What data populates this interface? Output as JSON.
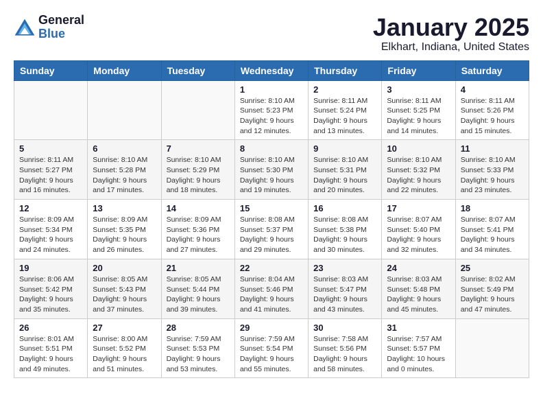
{
  "header": {
    "logo_general": "General",
    "logo_blue": "Blue",
    "month_title": "January 2025",
    "location": "Elkhart, Indiana, United States"
  },
  "days_of_week": [
    "Sunday",
    "Monday",
    "Tuesday",
    "Wednesday",
    "Thursday",
    "Friday",
    "Saturday"
  ],
  "weeks": [
    [
      {
        "day": "",
        "info": ""
      },
      {
        "day": "",
        "info": ""
      },
      {
        "day": "",
        "info": ""
      },
      {
        "day": "1",
        "info": "Sunrise: 8:10 AM\nSunset: 5:23 PM\nDaylight: 9 hours\nand 12 minutes."
      },
      {
        "day": "2",
        "info": "Sunrise: 8:11 AM\nSunset: 5:24 PM\nDaylight: 9 hours\nand 13 minutes."
      },
      {
        "day": "3",
        "info": "Sunrise: 8:11 AM\nSunset: 5:25 PM\nDaylight: 9 hours\nand 14 minutes."
      },
      {
        "day": "4",
        "info": "Sunrise: 8:11 AM\nSunset: 5:26 PM\nDaylight: 9 hours\nand 15 minutes."
      }
    ],
    [
      {
        "day": "5",
        "info": "Sunrise: 8:11 AM\nSunset: 5:27 PM\nDaylight: 9 hours\nand 16 minutes."
      },
      {
        "day": "6",
        "info": "Sunrise: 8:10 AM\nSunset: 5:28 PM\nDaylight: 9 hours\nand 17 minutes."
      },
      {
        "day": "7",
        "info": "Sunrise: 8:10 AM\nSunset: 5:29 PM\nDaylight: 9 hours\nand 18 minutes."
      },
      {
        "day": "8",
        "info": "Sunrise: 8:10 AM\nSunset: 5:30 PM\nDaylight: 9 hours\nand 19 minutes."
      },
      {
        "day": "9",
        "info": "Sunrise: 8:10 AM\nSunset: 5:31 PM\nDaylight: 9 hours\nand 20 minutes."
      },
      {
        "day": "10",
        "info": "Sunrise: 8:10 AM\nSunset: 5:32 PM\nDaylight: 9 hours\nand 22 minutes."
      },
      {
        "day": "11",
        "info": "Sunrise: 8:10 AM\nSunset: 5:33 PM\nDaylight: 9 hours\nand 23 minutes."
      }
    ],
    [
      {
        "day": "12",
        "info": "Sunrise: 8:09 AM\nSunset: 5:34 PM\nDaylight: 9 hours\nand 24 minutes."
      },
      {
        "day": "13",
        "info": "Sunrise: 8:09 AM\nSunset: 5:35 PM\nDaylight: 9 hours\nand 26 minutes."
      },
      {
        "day": "14",
        "info": "Sunrise: 8:09 AM\nSunset: 5:36 PM\nDaylight: 9 hours\nand 27 minutes."
      },
      {
        "day": "15",
        "info": "Sunrise: 8:08 AM\nSunset: 5:37 PM\nDaylight: 9 hours\nand 29 minutes."
      },
      {
        "day": "16",
        "info": "Sunrise: 8:08 AM\nSunset: 5:38 PM\nDaylight: 9 hours\nand 30 minutes."
      },
      {
        "day": "17",
        "info": "Sunrise: 8:07 AM\nSunset: 5:40 PM\nDaylight: 9 hours\nand 32 minutes."
      },
      {
        "day": "18",
        "info": "Sunrise: 8:07 AM\nSunset: 5:41 PM\nDaylight: 9 hours\nand 34 minutes."
      }
    ],
    [
      {
        "day": "19",
        "info": "Sunrise: 8:06 AM\nSunset: 5:42 PM\nDaylight: 9 hours\nand 35 minutes."
      },
      {
        "day": "20",
        "info": "Sunrise: 8:05 AM\nSunset: 5:43 PM\nDaylight: 9 hours\nand 37 minutes."
      },
      {
        "day": "21",
        "info": "Sunrise: 8:05 AM\nSunset: 5:44 PM\nDaylight: 9 hours\nand 39 minutes."
      },
      {
        "day": "22",
        "info": "Sunrise: 8:04 AM\nSunset: 5:46 PM\nDaylight: 9 hours\nand 41 minutes."
      },
      {
        "day": "23",
        "info": "Sunrise: 8:03 AM\nSunset: 5:47 PM\nDaylight: 9 hours\nand 43 minutes."
      },
      {
        "day": "24",
        "info": "Sunrise: 8:03 AM\nSunset: 5:48 PM\nDaylight: 9 hours\nand 45 minutes."
      },
      {
        "day": "25",
        "info": "Sunrise: 8:02 AM\nSunset: 5:49 PM\nDaylight: 9 hours\nand 47 minutes."
      }
    ],
    [
      {
        "day": "26",
        "info": "Sunrise: 8:01 AM\nSunset: 5:51 PM\nDaylight: 9 hours\nand 49 minutes."
      },
      {
        "day": "27",
        "info": "Sunrise: 8:00 AM\nSunset: 5:52 PM\nDaylight: 9 hours\nand 51 minutes."
      },
      {
        "day": "28",
        "info": "Sunrise: 7:59 AM\nSunset: 5:53 PM\nDaylight: 9 hours\nand 53 minutes."
      },
      {
        "day": "29",
        "info": "Sunrise: 7:59 AM\nSunset: 5:54 PM\nDaylight: 9 hours\nand 55 minutes."
      },
      {
        "day": "30",
        "info": "Sunrise: 7:58 AM\nSunset: 5:56 PM\nDaylight: 9 hours\nand 58 minutes."
      },
      {
        "day": "31",
        "info": "Sunrise: 7:57 AM\nSunset: 5:57 PM\nDaylight: 10 hours\nand 0 minutes."
      },
      {
        "day": "",
        "info": ""
      }
    ]
  ]
}
